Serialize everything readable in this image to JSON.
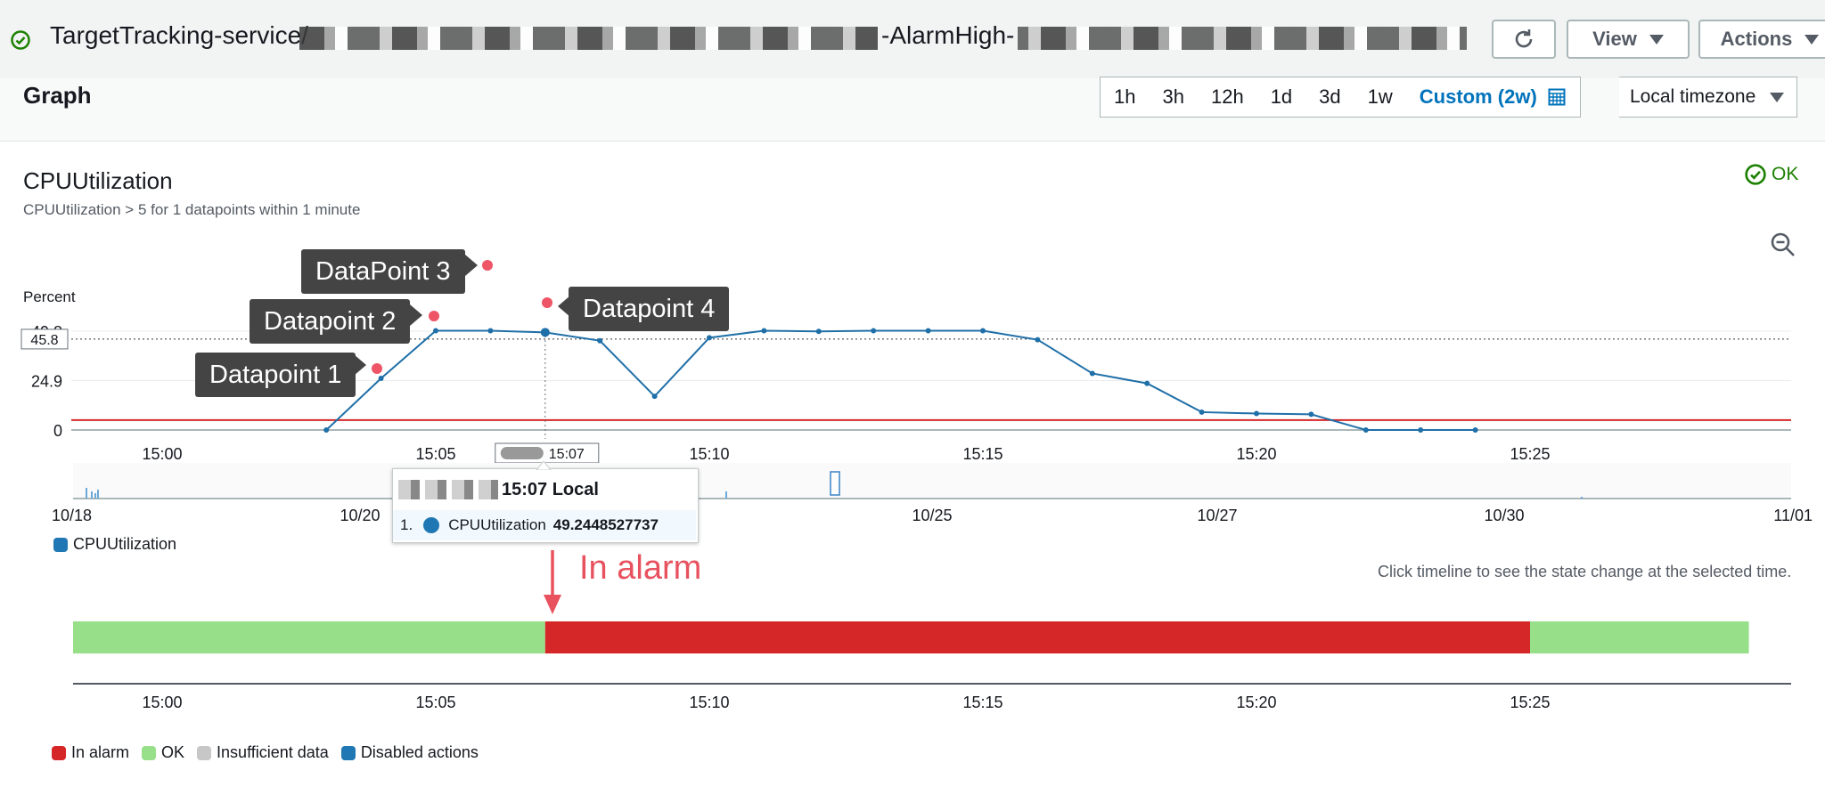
{
  "header": {
    "title": "TargetTracking-service/",
    "title_suffix": "-AlarmHigh-",
    "view_label": "View",
    "actions_label": "Actions"
  },
  "graph_section": {
    "title": "Graph",
    "ranges": [
      "1h",
      "3h",
      "12h",
      "1d",
      "3d",
      "1w"
    ],
    "custom_range": "Custom (2w)",
    "timezone": "Local timezone"
  },
  "metric": {
    "name": "CPUUtilization",
    "description": "CPUUtilization > 5 for 1 datapoints within 1 minute",
    "state": "OK",
    "y_unit": "Percent"
  },
  "chart_data": {
    "type": "line",
    "ylabel": "Percent",
    "y_ticks": [
      "0",
      "24.9",
      "49.8"
    ],
    "threshold_label": "45.8",
    "threshold": 5,
    "x_ticks": [
      "15:00",
      "15:05",
      "15:10",
      "15:15",
      "15:20",
      "15:25"
    ],
    "hover_tick": "15:07",
    "series": [
      {
        "name": "CPUUtilization",
        "color": "#1f6fa8",
        "x": [
          "15:03",
          "15:04",
          "15:05",
          "15:06",
          "15:07",
          "15:08",
          "15:09",
          "15:10",
          "15:11",
          "15:12",
          "15:13",
          "15:14",
          "15:15",
          "15:16",
          "15:17",
          "15:18",
          "15:19",
          "15:20",
          "15:21",
          "15:22",
          "15:23",
          "15:24"
        ],
        "values": [
          0,
          26,
          50,
          50,
          49.2,
          45,
          17,
          46.5,
          50,
          49.7,
          50,
          50,
          50,
          45.5,
          28.5,
          23.5,
          9,
          8.3,
          7.9,
          0,
          0,
          0
        ]
      }
    ],
    "threshold_line": 45.8,
    "overview_ticks": [
      "10/18",
      "10/20",
      "10/25",
      "10/27",
      "10/30",
      "11/01"
    ]
  },
  "callouts": [
    "Datapoint 1",
    "Datapoint 2",
    "DataPoint 3",
    "Datapoint 4"
  ],
  "tooltip": {
    "time": "15:07 Local",
    "index": "1.",
    "metric": "CPUUtilization",
    "value": "49.2448527737"
  },
  "series_legend": "CPUUtilization",
  "annotation": "In alarm",
  "timeline": {
    "hint": "Click timeline to see the state change at the selected time.",
    "ticks": [
      "15:00",
      "15:05",
      "15:10",
      "15:15",
      "15:20",
      "15:25"
    ],
    "segments": [
      {
        "state": "OK",
        "from": "14:58",
        "to": "15:07"
      },
      {
        "state": "In alarm",
        "from": "15:07",
        "to": "15:25"
      },
      {
        "state": "OK",
        "from": "15:25",
        "to": "15:29"
      }
    ],
    "legend": [
      {
        "label": "In alarm",
        "color": "#d62728"
      },
      {
        "label": "OK",
        "color": "#98df8a"
      },
      {
        "label": "Insufficient data",
        "color": "#c7c7c7"
      },
      {
        "label": "Disabled actions",
        "color": "#1f77b4"
      }
    ]
  },
  "colors": {
    "ok": "#98df8a",
    "alarm": "#d62728",
    "line": "#1f6fa8",
    "threshold": "#d62728",
    "accent": "#0073bb"
  }
}
